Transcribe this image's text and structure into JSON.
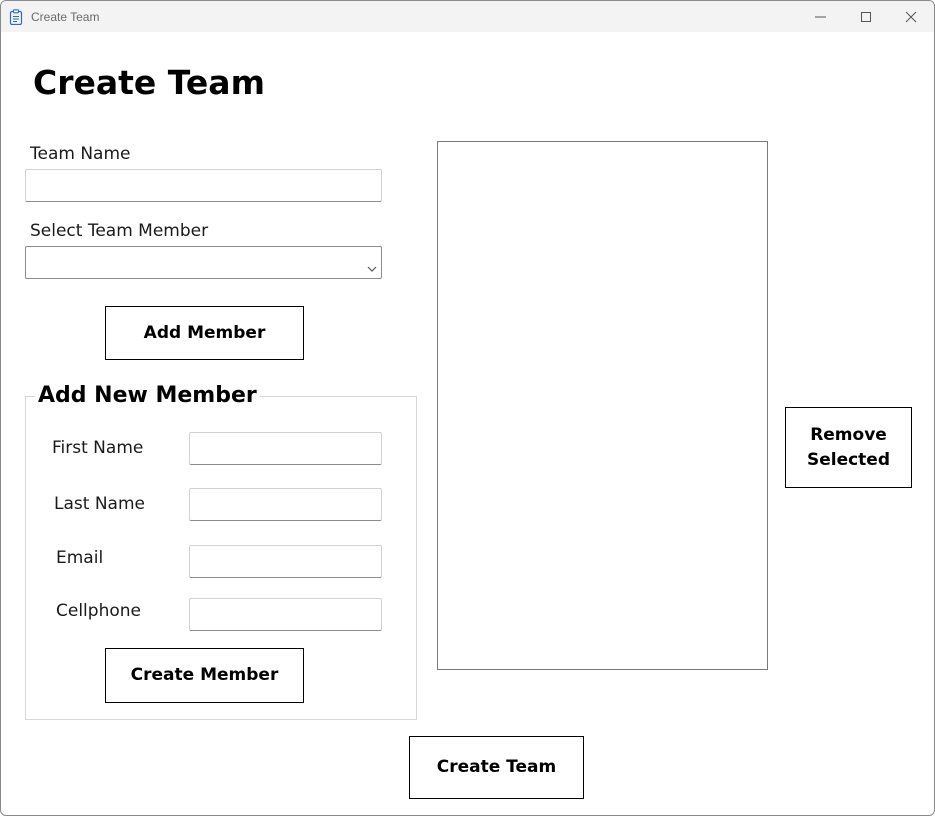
{
  "window": {
    "title": "Create Team",
    "icon": "clipboard-icon",
    "controls": [
      "minimize-icon",
      "maximize-icon",
      "close-icon"
    ]
  },
  "page": {
    "heading": "Create Team"
  },
  "team_form": {
    "team_name_label": "Team Name",
    "team_name_value": "",
    "select_member_label": "Select Team Member",
    "select_member_value": "",
    "add_member_label": "Add Member"
  },
  "new_member": {
    "title": "Add New Member",
    "first_name_label": "First Name",
    "last_name_label": "Last Name",
    "email_label": "Email",
    "cellphone_label": "Cellphone",
    "first_name_value": "",
    "last_name_value": "",
    "email_value": "",
    "cellphone_value": "",
    "create_member_label": "Create Member"
  },
  "members_list": {
    "items": []
  },
  "remove_selected_label": "Remove Selected",
  "create_team_label": "Create Team",
  "colors": {
    "titlebar": "#f3f3f3",
    "border": "#8c8c8c",
    "icon_blue": "#2b6cc4"
  }
}
